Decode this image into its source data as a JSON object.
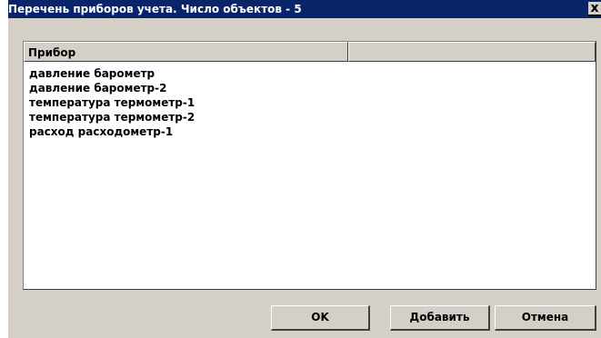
{
  "window": {
    "title": "Перечень приборов учета. Число объектов - 5",
    "close_label": "x"
  },
  "list": {
    "columns": [
      "Прибор",
      ""
    ],
    "items": [
      "давление барометр",
      "давление барометр-2",
      "температура термометр-1",
      "температура термометр-2",
      "расход расходометр-1"
    ]
  },
  "buttons": {
    "ok": "OK",
    "add": "Добавить",
    "cancel": "Отмена"
  }
}
